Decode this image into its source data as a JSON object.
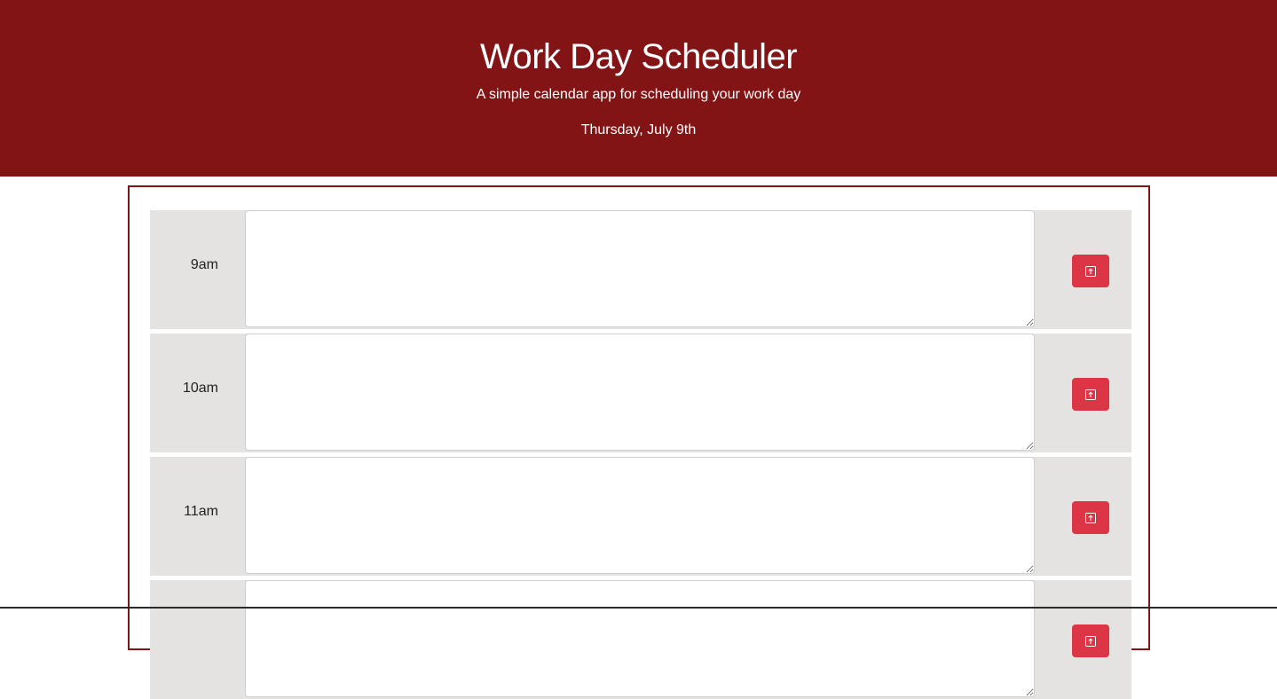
{
  "header": {
    "title": "Work Day Scheduler",
    "subtitle": "A simple calendar app for scheduling your work day",
    "current_day": "Thursday, July 9th"
  },
  "colors": {
    "header_bg": "#821415",
    "block_bg": "#e4e3e1",
    "save_button": "#dc3545"
  },
  "time_blocks": [
    {
      "hour": "9am",
      "description": "",
      "save_icon": "save-icon"
    },
    {
      "hour": "10am",
      "description": "",
      "save_icon": "save-icon"
    },
    {
      "hour": "11am",
      "description": "",
      "save_icon": "save-icon"
    },
    {
      "hour": "",
      "description": "",
      "save_icon": "save-icon"
    }
  ]
}
